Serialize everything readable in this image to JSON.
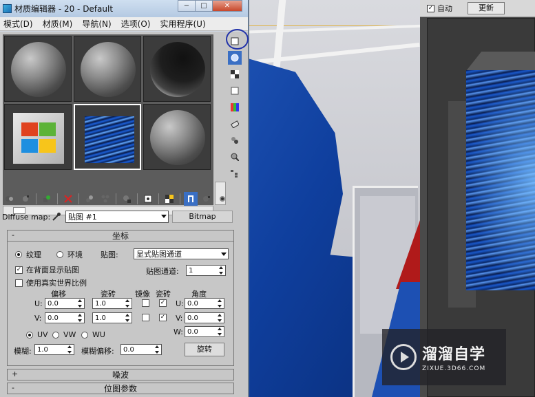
{
  "window": {
    "title": "材质编辑器 - 20 - Default",
    "minimize_label": "−",
    "maximize_label": "□",
    "close_label": "✕"
  },
  "menu": [
    "模式(D)",
    "材质(M)",
    "导航(N)",
    "选项(O)",
    "实用程序(U)"
  ],
  "diffuse": {
    "label": "Diffuse map:",
    "map_name": "贴图 #1",
    "type_button": "Bitmap"
  },
  "coords": {
    "title": "坐标",
    "texture_label": "纹理",
    "env_label": "环境",
    "map_label": "贴图:",
    "mapping_value": "显式贴图通道",
    "show_back_label": "在背面显示贴图",
    "show_back_checked": true,
    "real_world_label": "使用真实世界比例",
    "real_world_checked": false,
    "map_channel_label": "贴图通道:",
    "map_channel_value": "1",
    "offset_header": "偏移",
    "tiling_header": "瓷砖",
    "mirror_header": "镜像",
    "tile_header": "瓷砖",
    "angle_header": "角度",
    "u_label": "U:",
    "v_label": "V:",
    "w_label": "W:",
    "u_offset": "0.0",
    "v_offset": "0.0",
    "u_tiling": "1.0",
    "v_tiling": "1.0",
    "u_mirror": false,
    "v_mirror": false,
    "u_tile": true,
    "v_tile": true,
    "u_angle": "0.0",
    "v_angle": "0.0",
    "w_angle": "0.0",
    "uv_label": "UV",
    "vw_label": "VW",
    "wu_label": "WU",
    "blur_label": "模糊:",
    "blur_value": "1.0",
    "blur_offset_label": "模糊偏移:",
    "blur_offset_value": "0.0",
    "rotate_button": "旋转",
    "check_mark": "✓"
  },
  "rollouts": {
    "noise_title": "噪波",
    "noise_sign": "+",
    "bitmap_title": "位图参数",
    "bitmap_sign": "-",
    "coords_sign": "-"
  },
  "preview": {
    "auto_label": "自动",
    "auto_checked": true,
    "update_button": "更新"
  },
  "watermark": {
    "title": "溜溜自学",
    "url": "ZIXUE.3D66.COM"
  },
  "colors": {
    "accent": "#3a6fc4",
    "titlebar": "#b4c9e2",
    "panel": "#c7c7c7"
  },
  "icons": {
    "slot_tools": [
      "sample-type-icon",
      "backlight-icon",
      "background-icon",
      "uv-tiling-icon",
      "video-color-check-icon",
      "make-preview-icon",
      "options-icon",
      "select-by-material-icon",
      "material-map-navigator-icon"
    ],
    "toolbar": [
      "get-material-icon",
      "put-material-icon",
      "assign-material-icon",
      "delete-icon",
      "copy-material-icon",
      "make-unique-icon",
      "put-to-library-icon",
      "material-id-icon",
      "show-map-icon",
      "show-end-result-icon",
      "go-to-parent-icon",
      "go-forward-icon"
    ]
  }
}
